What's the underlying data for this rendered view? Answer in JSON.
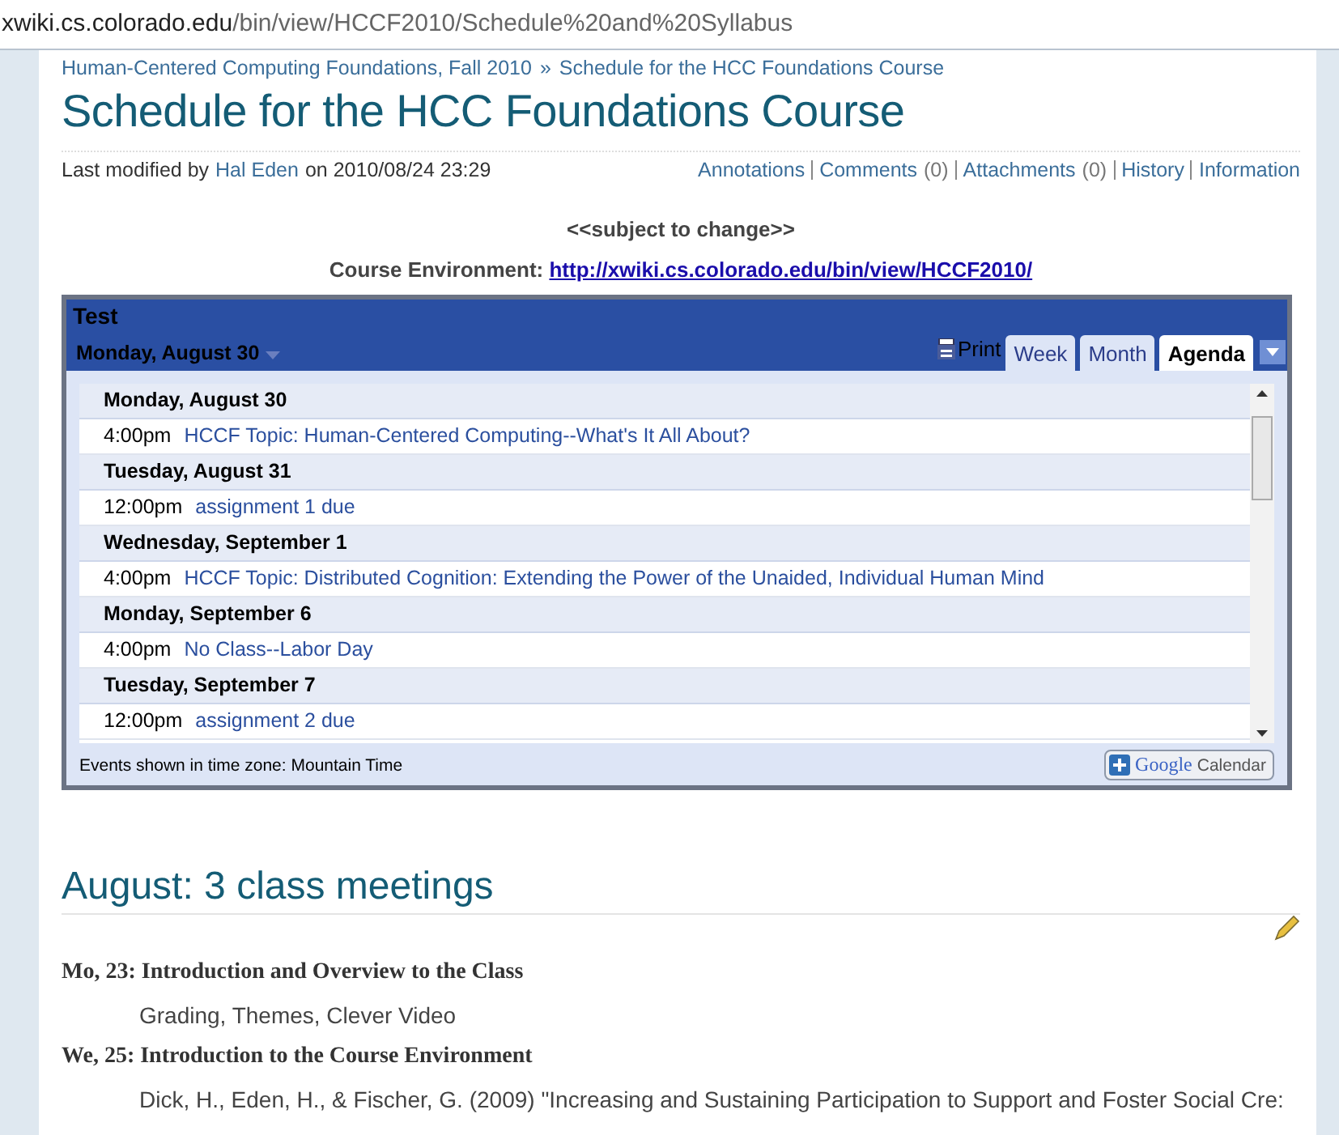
{
  "address_bar": {
    "host": "xwiki.cs.colorado.edu",
    "path": "/bin/view/HCCF2010/Schedule%20and%20Syllabus"
  },
  "breadcrumb": [
    "Human-Centered Computing Foundations, Fall 2010",
    "Schedule for the HCC Foundations Course"
  ],
  "breadcrumb_separator": "»",
  "title": "Schedule for the HCC Foundations Course",
  "meta": {
    "prefix": "Last modified by",
    "author": "Hal Eden",
    "date": "on 2010/08/24 23:29"
  },
  "doc_links": [
    {
      "label": "Annotations"
    },
    {
      "label": "Comments",
      "count": "(0)"
    },
    {
      "label": "Attachments",
      "count": "(0)"
    },
    {
      "label": "History"
    },
    {
      "label": "Information"
    }
  ],
  "notice": "<<subject to change>>",
  "course_env": {
    "label": "Course Environment:",
    "url": "http://xwiki.cs.colorado.edu/bin/view/HCCF2010/"
  },
  "calendar": {
    "title": "Test",
    "date": "Monday, August 30",
    "print": "Print",
    "tabs": [
      {
        "label": "Week",
        "selected": false
      },
      {
        "label": "Month",
        "selected": false
      },
      {
        "label": "Agenda",
        "selected": true
      }
    ],
    "days": [
      {
        "date": "Monday, August 30",
        "events": [
          {
            "time": "4:00pm",
            "title": "HCCF Topic: Human-Centered Computing--What's It All About?"
          }
        ]
      },
      {
        "date": "Tuesday, August 31",
        "events": [
          {
            "time": "12:00pm",
            "title": "assignment 1 due"
          }
        ]
      },
      {
        "date": "Wednesday, September 1",
        "events": [
          {
            "time": "4:00pm",
            "title": "HCCF Topic: Distributed Cognition: Extending the Power of the Unaided, Individual Human Mind"
          }
        ]
      },
      {
        "date": "Monday, September 6",
        "events": [
          {
            "time": "4:00pm",
            "title": "No Class--Labor Day"
          }
        ]
      },
      {
        "date": "Tuesday, September 7",
        "events": [
          {
            "time": "12:00pm",
            "title": "assignment 2 due"
          }
        ]
      }
    ],
    "timezone": "Events shown in time zone: Mountain Time",
    "badge": {
      "brand": "Google",
      "product": "Calendar"
    }
  },
  "section": {
    "heading": "August: 3 class meetings",
    "items": [
      {
        "heading": "Mo, 23: Introduction and Overview to the Class",
        "detail": "Grading, Themes, Clever Video"
      },
      {
        "heading": "We, 25: Introduction to the Course Environment",
        "detail": "Dick, H., Eden, H., & Fischer, G. (2009) \"Increasing and Sustaining Participation to Support and Foster Social Cre:"
      }
    ]
  }
}
